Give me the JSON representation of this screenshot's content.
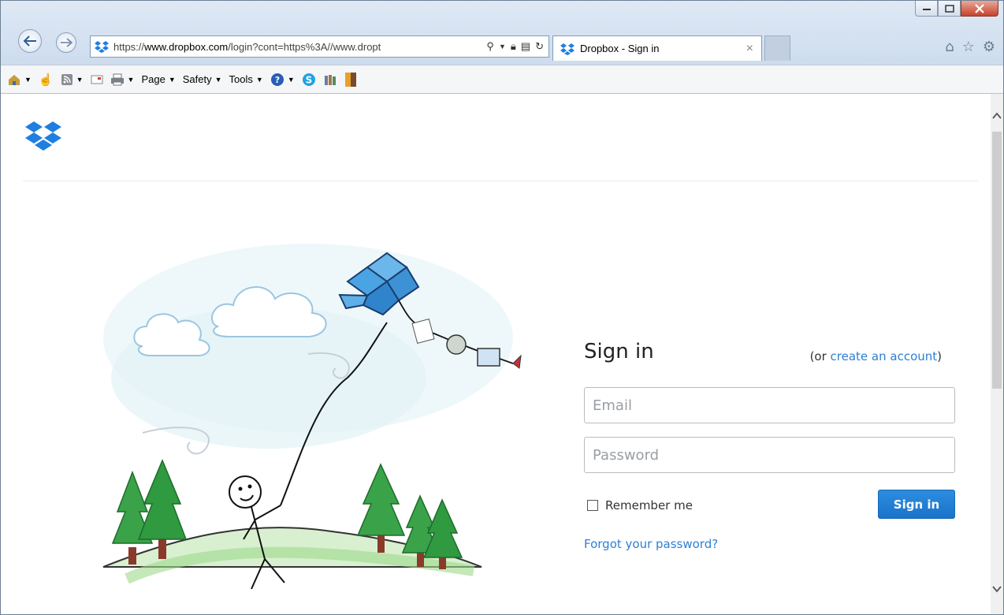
{
  "browser": {
    "url_prefix": "https://",
    "url_domain": "www.dropbox.com",
    "url_rest": "/login?cont=https%3A//www.dropt",
    "tab_title": "Dropbox - Sign in",
    "tab_close": "×",
    "command_bar": {
      "page_label": "Page",
      "safety_label": "Safety",
      "tools_label": "Tools"
    }
  },
  "signin": {
    "title": "Sign in",
    "or_prefix": "(or ",
    "create_account_link": "create an account",
    "or_suffix": ")",
    "email_placeholder": "Email",
    "password_placeholder": "Password",
    "remember_label": "Remember me",
    "submit_label": "Sign in",
    "forgot_link": "Forgot your password?"
  },
  "colors": {
    "accent": "#2d7fd3",
    "button": "#1f7bd1",
    "dropbox_blue": "#1e7fe0"
  }
}
